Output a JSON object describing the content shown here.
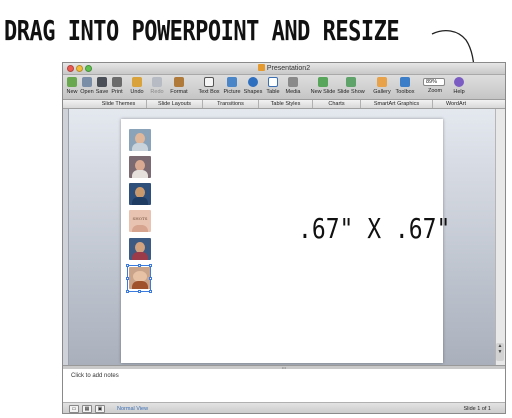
{
  "annotation": {
    "caption": "DRAG INTO POWERPOINT AND RESIZE"
  },
  "window": {
    "title": "Presentation2",
    "traffic_lights": [
      "close",
      "minimize",
      "zoom"
    ]
  },
  "toolbar": {
    "items": [
      {
        "label": "New",
        "icon": "new-icon"
      },
      {
        "label": "Open",
        "icon": "open-icon"
      },
      {
        "label": "Save",
        "icon": "save-icon"
      },
      {
        "label": "Print",
        "icon": "print-icon"
      },
      {
        "label": "Undo",
        "icon": "undo-icon"
      },
      {
        "label": "Redo",
        "icon": "redo-icon"
      },
      {
        "label": "Format",
        "icon": "format-icon"
      },
      {
        "label": "Text Box",
        "icon": "text-box-icon"
      },
      {
        "label": "Picture",
        "icon": "picture-icon"
      },
      {
        "label": "Shapes",
        "icon": "shapes-icon"
      },
      {
        "label": "Table",
        "icon": "table-icon"
      },
      {
        "label": "Media",
        "icon": "media-icon"
      },
      {
        "label": "New Slide",
        "icon": "new-slide-icon"
      },
      {
        "label": "Slide Show",
        "icon": "slide-show-icon"
      },
      {
        "label": "Gallery",
        "icon": "gallery-icon"
      },
      {
        "label": "Toolbox",
        "icon": "toolbox-icon"
      },
      {
        "label": "Zoom",
        "icon": "zoom-icon"
      },
      {
        "label": "Help",
        "icon": "help-icon"
      }
    ],
    "zoom_value": "89%"
  },
  "ribbon_tabs": [
    "Slide Themes",
    "Slide Layouts",
    "Transitions",
    "Table Styles",
    "Charts",
    "SmartArt Graphics",
    "WordArt"
  ],
  "slide": {
    "size_text": ".67\" X .67\"",
    "photos": [
      {
        "icon": "photo-thumbnail"
      },
      {
        "icon": "photo-thumbnail"
      },
      {
        "icon": "photo-thumbnail"
      },
      {
        "icon": "photo-thumbnail",
        "text": "SHOTS"
      },
      {
        "icon": "photo-thumbnail"
      },
      {
        "icon": "photo-thumbnail"
      }
    ],
    "colors": {
      "selection": "#3b7be0",
      "background": "#ffffff"
    }
  },
  "notes": {
    "placeholder": "Click to add notes"
  },
  "statusbar": {
    "view_label": "Normal View",
    "slide_counter": "Slide 1 of 1"
  }
}
